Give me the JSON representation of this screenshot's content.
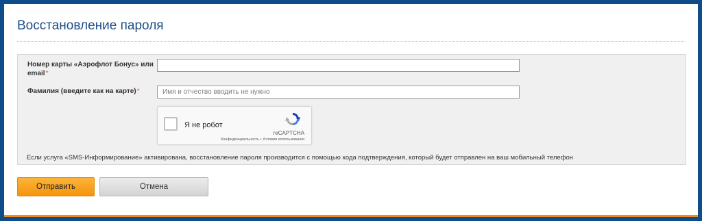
{
  "title": "Восстановление пароля",
  "fields": {
    "card": {
      "label": "Номер карты «Аэрофлот Бонус» или email",
      "required_mark": "*",
      "value": ""
    },
    "surname": {
      "label": "Фамилия (введите как на карте)",
      "required_mark": "*",
      "placeholder": "Имя и отчество вводить не нужно",
      "value": ""
    }
  },
  "captcha": {
    "checkbox_label": "Я не робот",
    "brand": "reCAPTCHA",
    "links": "Конфиденциальность • Условия использования"
  },
  "note": "Если услуга «SMS-Информирование» активирована, восстановление пароля производится с помощью кода подтверждения, который будет отправлен на ваш мобильный телефон",
  "buttons": {
    "submit": "Отправить",
    "cancel": "Отмена"
  },
  "colors": {
    "frame": "#0f4c8a",
    "title": "#1f4e86",
    "required": "#e86c1e",
    "submit": "#f5a11f",
    "accent_bar": "#f08a1c"
  }
}
